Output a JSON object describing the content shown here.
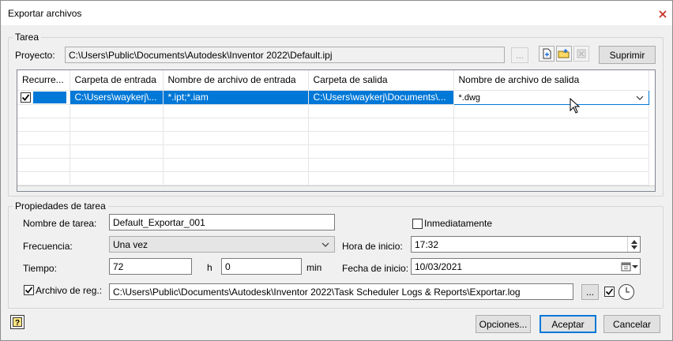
{
  "window": {
    "title": "Exportar archivos"
  },
  "tarea": {
    "legend": "Tarea",
    "proyecto_label": "Proyecto:",
    "proyecto_value": "C:\\Users\\Public\\Documents\\Autodesk\\Inventor 2022\\Default.ipj",
    "browse_label": "...",
    "suprimir_label": "Suprimir",
    "icons": [
      "add-file-icon",
      "add-folder-icon",
      "remove-icon"
    ]
  },
  "grid": {
    "columns": [
      "Recurre...",
      "Carpeta de entrada",
      "Nombre de archivo de entrada",
      "Carpeta de salida",
      "Nombre de archivo de salida"
    ],
    "rows": [
      {
        "recurse_checked": true,
        "carpeta_entrada": "C:\\Users\\waykerj\\...",
        "nombre_entrada": "*.ipt;*.iam",
        "carpeta_salida": "C:\\Users\\waykerj\\Documents\\...",
        "nombre_salida": "*.dwg"
      }
    ]
  },
  "propiedades": {
    "legend": "Propiedades de tarea",
    "nombre_label": "Nombre de tarea:",
    "nombre_value": "Default_Exportar_001",
    "inmediatamente_label": "Inmediatamente",
    "inmediatamente_checked": false,
    "frecuencia_label": "Frecuencia:",
    "frecuencia_value": "Una vez",
    "hora_label": "Hora de inicio:",
    "hora_value": "17:32",
    "tiempo_label": "Tiempo:",
    "tiempo_h_value": "72",
    "tiempo_h_unit": "h",
    "tiempo_min_value": "0",
    "tiempo_min_unit": "min",
    "fecha_label": "Fecha de inicio:",
    "fecha_value": "10/03/2021",
    "archivo_label": "Archivo de reg.:",
    "archivo_checked": true,
    "archivo_value": "C:\\Users\\Public\\Documents\\Autodesk\\Inventor 2022\\Task Scheduler Logs & Reports\\Exportar.log",
    "archivo_browse": "...",
    "archivo_check2": true
  },
  "footer": {
    "opciones_label": "Opciones...",
    "aceptar_label": "Aceptar",
    "cancelar_label": "Cancelar"
  },
  "colors": {
    "selection": "#0078d7",
    "background": "#f0f0f0"
  }
}
